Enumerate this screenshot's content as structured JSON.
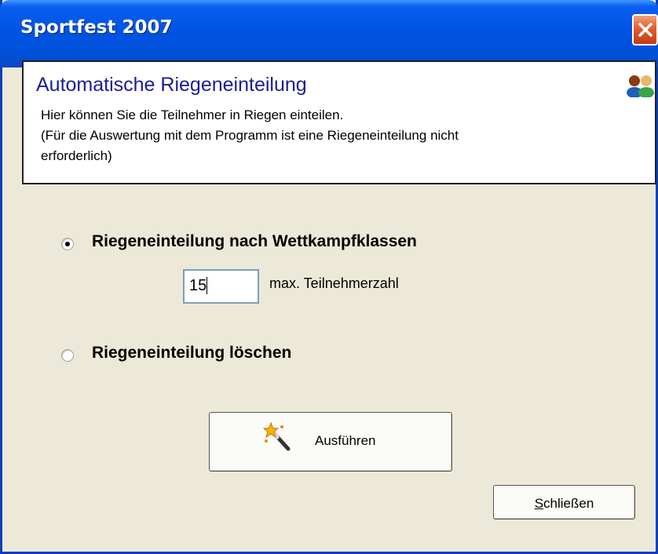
{
  "window": {
    "title": "Sportfest 2007",
    "close_icon": "close-x-icon"
  },
  "header": {
    "title": "Automatische Riegeneinteilung",
    "lines": [
      "Hier können Sie die Teilnehmer in Riegen einteilen.",
      "(Für die Auswertung mit dem Programm ist eine Riegeneinteilung nicht",
      "erforderlich)"
    ],
    "icon": "users-icon"
  },
  "options": {
    "by_class": {
      "label": "Riegeneinteilung nach Wettkampfklassen",
      "selected": true
    },
    "delete": {
      "label": "Riegeneinteilung löschen",
      "selected": false
    }
  },
  "max_participants": {
    "value": "15",
    "label": "max. Teilnehmerzahl"
  },
  "buttons": {
    "execute": {
      "label": "Ausführen",
      "icon": "magic-wand-icon"
    },
    "close": {
      "label_underlined": "S",
      "label_rest": "chließen"
    }
  }
}
